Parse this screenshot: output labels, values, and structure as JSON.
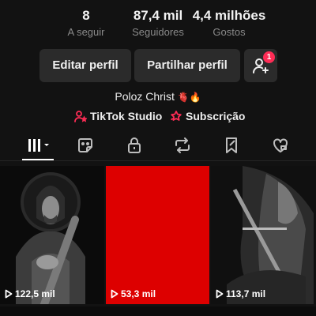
{
  "stats": [
    {
      "value": "8",
      "label": "A seguir"
    },
    {
      "value": "87,4 mil",
      "label": "Seguidores"
    },
    {
      "value": "4,4 milhões",
      "label": "Gostos"
    }
  ],
  "actions": {
    "edit_label": "Editar perfil",
    "share_label": "Partilhar perfil",
    "add_friends_badge": "1"
  },
  "profile": {
    "name": "Poloz Christ",
    "name_emojis": "🫀🔥"
  },
  "links": {
    "studio_label": "TikTok Studio",
    "subscription_label": "Subscrição"
  },
  "tabs": [
    {
      "icon": "grid-icon",
      "active": true
    },
    {
      "icon": "repost-sticker-icon"
    },
    {
      "icon": "lock-icon"
    },
    {
      "icon": "repost-icon"
    },
    {
      "icon": "saved-icon"
    },
    {
      "icon": "liked-icon"
    }
  ],
  "videos": [
    {
      "views": "122,5 mil"
    },
    {
      "views": "53,3 mil"
    },
    {
      "views": "113,7 mil"
    }
  ],
  "colors": {
    "background": "#121212",
    "button": "#2b2b2b",
    "accent": "#fe2c55",
    "red_thumbnail": "#dd0000"
  }
}
